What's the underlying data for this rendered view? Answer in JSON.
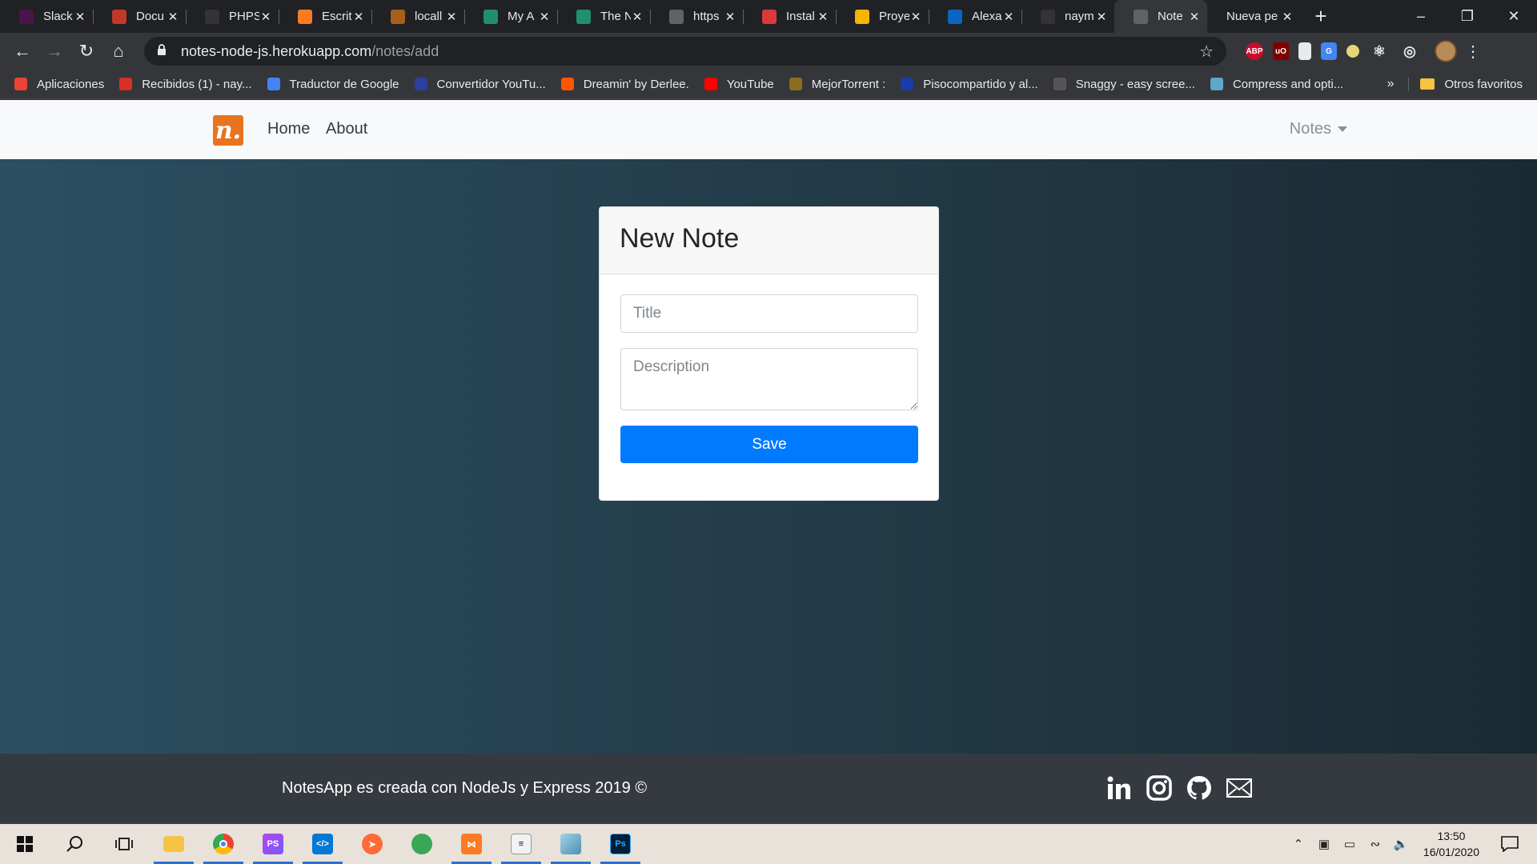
{
  "browser": {
    "tabs": [
      {
        "title": "Slack",
        "favicon": "slack-icon",
        "color": "#4a154b"
      },
      {
        "title": "Docu",
        "favicon": "document-icon",
        "color": "#c0392b"
      },
      {
        "title": "PHPS",
        "favicon": "github-icon",
        "color": "#333333"
      },
      {
        "title": "Escrit",
        "favicon": "xampp-icon",
        "color": "#fb7a24"
      },
      {
        "title": "locall",
        "favicon": "traefik-icon",
        "color": "#a65f1c"
      },
      {
        "title": "My A",
        "favicon": "code-icon",
        "color": "#1e8f6f"
      },
      {
        "title": "The N",
        "favicon": "code-icon",
        "color": "#1e8f6f"
      },
      {
        "title": "https",
        "favicon": "globe-icon",
        "color": "#5f6368"
      },
      {
        "title": "Instal",
        "favicon": "heart-icon",
        "color": "#d93a3a"
      },
      {
        "title": "Proye",
        "favicon": "slides-icon",
        "color": "#f4b400"
      },
      {
        "title": "Alexa",
        "favicon": "linkedin-icon",
        "color": "#0a66c2"
      },
      {
        "title": "naym",
        "favicon": "github-icon",
        "color": "#333333"
      },
      {
        "title": "Note",
        "favicon": "globe-icon",
        "color": "#5f6368",
        "active": true
      },
      {
        "title": "Nueva pe",
        "favicon": "",
        "color": "transparent"
      }
    ],
    "url": {
      "host": "notes-node-js.herokuapp.com",
      "path": "/notes/add"
    },
    "bookmarks": [
      {
        "label": "Aplicaciones",
        "icon": "apps-grid-icon",
        "color": "#ea4335"
      },
      {
        "label": "Recibidos (1) - nay...",
        "icon": "gmail-icon",
        "color": "#d93025"
      },
      {
        "label": "Traductor de Google",
        "icon": "translate-icon",
        "color": "#4285f4"
      },
      {
        "label": "Convertidor YouTu...",
        "icon": "converter-icon",
        "color": "#2c3e9e"
      },
      {
        "label": "Dreamin' by Derlee.",
        "icon": "soundcloud-icon",
        "color": "#ff5500"
      },
      {
        "label": "YouTube",
        "icon": "youtube-icon",
        "color": "#ff0000"
      },
      {
        "label": "MejorTorrent :",
        "icon": "torrent-icon",
        "color": "#8a6d1f"
      },
      {
        "label": "Pisocompartido y al...",
        "icon": "p-icon",
        "color": "#1a3ca8"
      },
      {
        "label": "Snaggy - easy scree...",
        "icon": "sg-icon",
        "color": "#555555"
      },
      {
        "label": "Compress and opti...",
        "icon": "compress-icon",
        "color": "#5fa7c7"
      }
    ],
    "bookmarks_more": "»",
    "other_bookmarks": "Otros favoritos"
  },
  "navbar": {
    "brand": "n.",
    "links": {
      "home": "Home",
      "about": "About"
    },
    "dropdown": "Notes"
  },
  "form": {
    "heading": "New Note",
    "title_placeholder": "Title",
    "description_placeholder": "Description",
    "save_label": "Save"
  },
  "footer": {
    "text": "NotesApp es creada con NodeJs y Express 2019 ©",
    "social": [
      "linkedin-icon",
      "instagram-icon",
      "github-icon",
      "mail-icon"
    ]
  },
  "taskbar": {
    "time": "13:50",
    "date": "16/01/2020"
  },
  "colors": {
    "primary": "#007bff",
    "brand": "#e8741f",
    "footer": "#343a40",
    "navbar": "#f8f9fa"
  }
}
